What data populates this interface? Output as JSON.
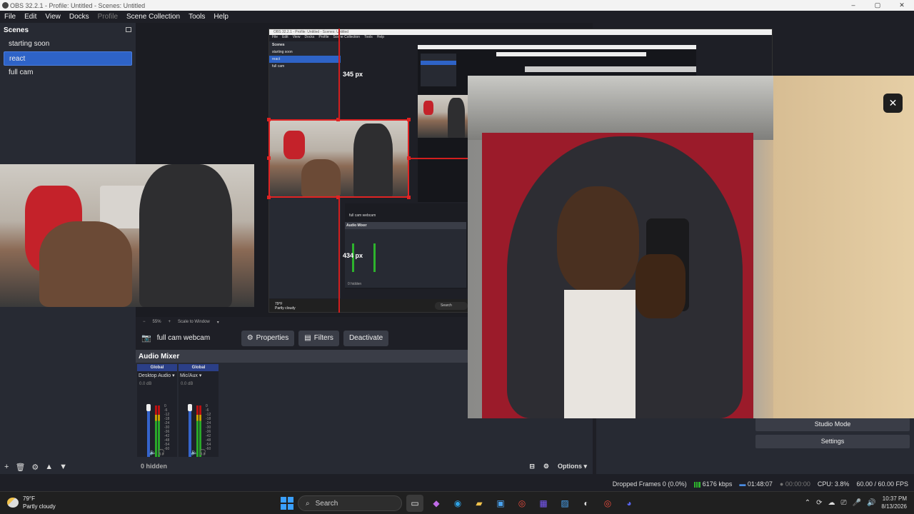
{
  "window": {
    "title": "OBS 32.2.1 - Profile: Untitled - Scenes: Untitled",
    "controls": [
      "–",
      "▢",
      "✕"
    ]
  },
  "menu": {
    "items": [
      "File",
      "Edit",
      "View",
      "Docks",
      "Profile",
      "Scene Collection",
      "Tools",
      "Help"
    ]
  },
  "scenes": {
    "header": "Scenes",
    "items": [
      {
        "label": "starting soon",
        "active": false
      },
      {
        "label": "react",
        "active": true
      },
      {
        "label": "full cam",
        "active": false
      }
    ],
    "toolbar": [
      "+",
      "🗑",
      "⚙",
      "▲",
      "▼"
    ]
  },
  "preview": {
    "guide_label_top": "345 px",
    "guide_label_left": "434 px",
    "zoom_minus": "−",
    "zoom_value": "55%",
    "zoom_plus": "+",
    "scale_mode": "Scale to Window"
  },
  "nested": {
    "title": "OBS 32.2.1 - Profile: Untitled - Scenes: Untitled",
    "menu": [
      "File",
      "Edit",
      "View",
      "Docks",
      "Profile",
      "Scene Collection",
      "Tools",
      "Help"
    ],
    "scenes_header": "Scenes",
    "scenes": [
      "starting soon",
      "react",
      "full cam"
    ],
    "source": "full cam webcam",
    "mixer_header": "Audio Mixer",
    "hidden": "0 hidden",
    "weather_temp": "79°F",
    "weather_desc": "Partly cloudy",
    "search": "Search"
  },
  "source_toolbar": {
    "source_name": "full cam webcam",
    "properties": "Properties",
    "filters": "Filters",
    "deactivate": "Deactivate"
  },
  "mixer": {
    "header": "Audio Mixer",
    "channels": [
      {
        "group": "Global",
        "name": "Desktop Audio",
        "db": "0.0 dB"
      },
      {
        "group": "Global",
        "name": "Mic/Aux",
        "db": "0.0 dB"
      }
    ],
    "scale": [
      "0",
      "-6",
      "-12",
      "-18",
      "-24",
      "-30",
      "-36",
      "-42",
      "-48",
      "-54",
      "-60"
    ],
    "hidden": "0 hidden",
    "options": "Options"
  },
  "controls": {
    "studio_mode": "Studio Mode",
    "settings": "Settings"
  },
  "status": {
    "dropped_frames": "Dropped Frames 0 (0.0%)",
    "bitrate": "6176 kbps",
    "stream_time": "01:48:07",
    "rec_time": "00:00:00",
    "cpu": "CPU: 3.8%",
    "fps": "60.00 / 60.00 FPS"
  },
  "taskbar": {
    "weather_temp": "79°F",
    "weather_desc": "Partly cloudy",
    "search_placeholder": "Search",
    "time": "10:37 PM",
    "date": "8/13/2026"
  },
  "popup": {
    "close": "✕"
  }
}
